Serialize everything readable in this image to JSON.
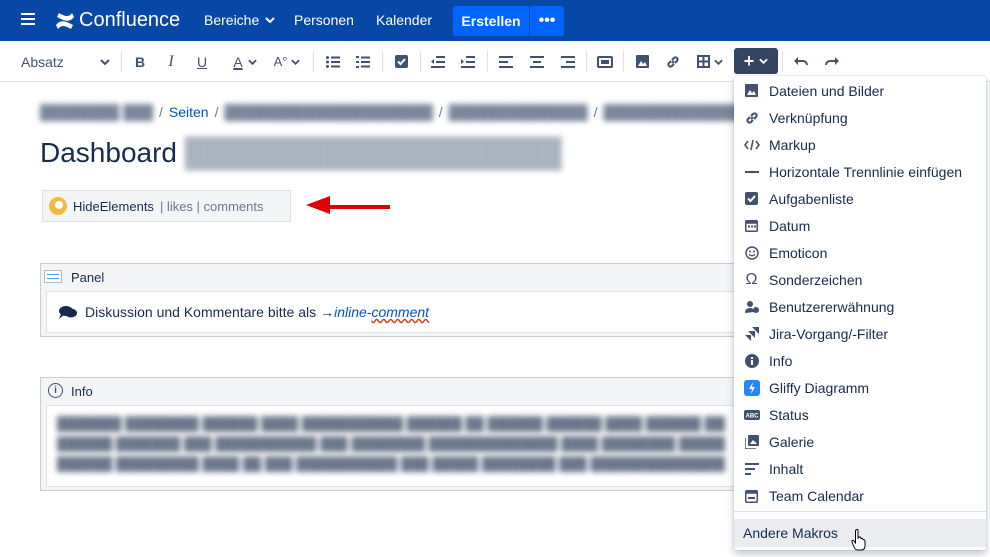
{
  "topnav": {
    "brand": "Confluence",
    "items": [
      "Bereiche",
      "Personen",
      "Kalender"
    ],
    "create_label": "Erstellen",
    "more_label": "•••"
  },
  "toolbar": {
    "paragraph_style": "Absatz",
    "insert_icon": "plus-icon"
  },
  "breadcrumb": {
    "items": [
      "Seiten"
    ]
  },
  "page": {
    "title": "Dashboard"
  },
  "hide_elements": {
    "name": "HideElements",
    "meta": "| likes | comments"
  },
  "panel": {
    "title": "Panel",
    "text": "Diskussion und Kommentare bitte als",
    "link_prefix": "→",
    "link_part1": "inline-",
    "link_part2": "comment"
  },
  "info": {
    "title": "Info"
  },
  "insert_menu": {
    "items": [
      {
        "label": "Dateien und Bilder",
        "icon": "image-icon"
      },
      {
        "label": "Verknüpfung",
        "icon": "link-icon"
      },
      {
        "label": "Markup",
        "icon": "code-icon"
      },
      {
        "label": "Horizontale Trennlinie einfügen",
        "icon": "horizontal-rule-icon"
      },
      {
        "label": "Aufgabenliste",
        "icon": "checkbox-icon"
      },
      {
        "label": "Datum",
        "icon": "calendar-icon"
      },
      {
        "label": "Emoticon",
        "icon": "emoticon-icon"
      },
      {
        "label": "Sonderzeichen",
        "icon": "omega-icon"
      },
      {
        "label": "Benutzererwähnung",
        "icon": "mention-icon"
      },
      {
        "label": "Jira-Vorgang/-Filter",
        "icon": "jira-icon"
      },
      {
        "label": "Info",
        "icon": "info-icon"
      },
      {
        "label": "Gliffy Diagramm",
        "icon": "gliffy-icon"
      },
      {
        "label": "Status",
        "icon": "status-icon"
      },
      {
        "label": "Galerie",
        "icon": "gallery-icon"
      },
      {
        "label": "Inhalt",
        "icon": "toc-icon"
      },
      {
        "label": "Team Calendar",
        "icon": "team-calendar-icon"
      }
    ],
    "other_macros": "Andere Makros"
  }
}
